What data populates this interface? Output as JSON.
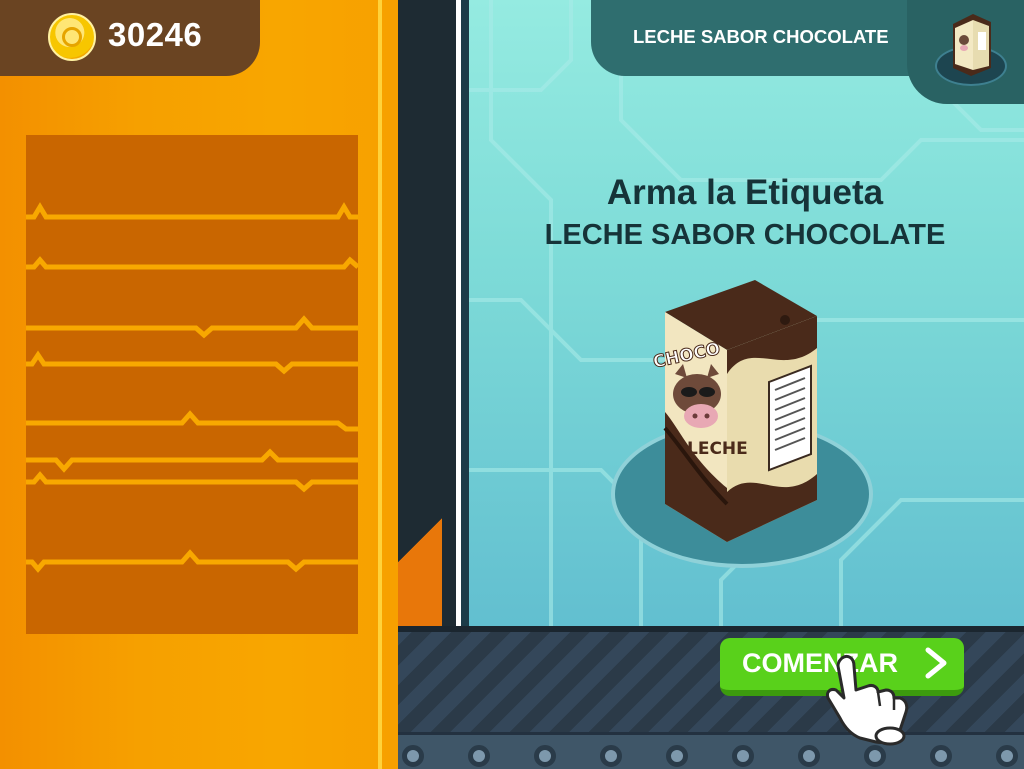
{
  "wallet": {
    "coins": "30246",
    "icon": "coin-icon"
  },
  "header": {
    "product_name": "LECHE SABOR CHOCOLATE",
    "thumbnail": "milk-carton-thumbnail"
  },
  "intro": {
    "title": "Arma la Etiqueta",
    "subtitle": "LECHE SABOR CHOCOLATE"
  },
  "product": {
    "brand_top": "CHOCO",
    "brand_bottom": "LECHE",
    "icon": "chocolate-milk-carton"
  },
  "actions": {
    "start_label": "COMENZAR"
  },
  "colors": {
    "orange": "#f6a000",
    "teal": "#7fdcd8",
    "header_teal": "#2f6e6f",
    "button_green": "#59d11b",
    "coin_bar": "#6a4422"
  }
}
